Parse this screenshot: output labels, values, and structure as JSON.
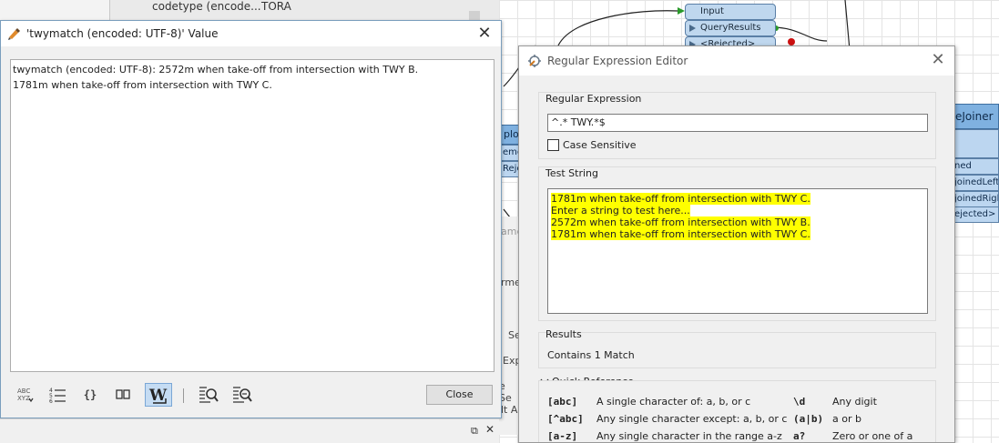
{
  "background": {
    "panel_label": "codetype (encode...",
    "panel_value": "TORA",
    "ports": [
      "Input",
      "QueryResults",
      "<Rejected>"
    ],
    "joiner": {
      "title": "eJoiner",
      "rows": [
        "ned",
        "joinedLeft",
        "joinedRigh",
        "ejected>"
      ]
    },
    "left_node": {
      "title": "ploc",
      "rows": [
        "eme",
        "Reje"
      ]
    },
    "side_texts": [
      "ame",
      "rme",
      "Se",
      "Exp",
      "e Se",
      "lt A"
    ]
  },
  "value_dialog": {
    "title": "'twymatch (encoded: UTF-8)' Value",
    "text": "twymatch (encoded: UTF-8): 2572m when take-off from intersection with TWY B.\n1781m when take-off from intersection with TWY C.",
    "toolbar": {
      "icons": [
        "spell-check-icon",
        "line-numbers-icon",
        "braces-icon",
        "columns-icon",
        "word-wrap-icon",
        "find-icon",
        "find-replace-icon"
      ],
      "close_label": "Close"
    }
  },
  "regex_editor": {
    "title": "Regular Expression Editor",
    "regex_label": "Regular Expression",
    "regex_value": "^.* TWY.*$",
    "case_sensitive_label": "Case Sensitive",
    "case_sensitive_checked": false,
    "test_string_label": "Test String",
    "test_lines": [
      "1781m when take-off from intersection with TWY C.",
      "Enter a string to test here...",
      "2572m when take-off from intersection with TWY B.",
      "1781m when take-off from intersection with TWY C."
    ],
    "results_label": "Results",
    "results_text": "Contains 1 Match",
    "quick_ref_label": "Quick Reference",
    "quick_ref": [
      {
        "code": "[abc]",
        "desc": "A single character of: a, b, or c",
        "code2": "\\d",
        "desc2": "Any digit"
      },
      {
        "code": "[^abc]",
        "desc": "Any single character except: a, b, or c",
        "code2": "(a|b)",
        "desc2": "a or b"
      },
      {
        "code": "[a-z]",
        "desc": "Any single character in the range a-z",
        "code2": "a?",
        "desc2": "Zero or one of a"
      }
    ]
  },
  "colors": {
    "highlight": "#ffff00",
    "active_tool": "#c5dcf3"
  }
}
